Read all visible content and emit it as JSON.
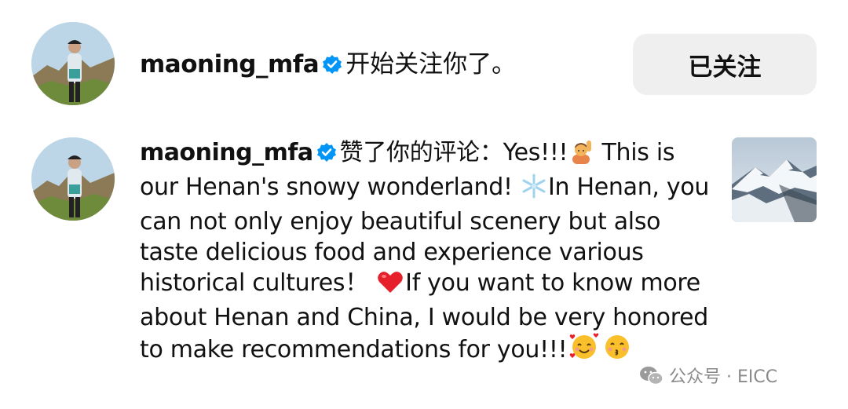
{
  "notifications": [
    {
      "username": "maoning_mfa",
      "action_text": "开始关注你了。",
      "button_label": "已关注"
    },
    {
      "username": "maoning_mfa",
      "action_text": "赞了你的评论：",
      "comment_parts": [
        "Yes!!!",
        " This is our Henan's snowy wonderland! ",
        "In Henan, you can not only enjoy beautiful scenery but also taste delicious food and experience various historical cultures！ ",
        "If you want to know more about Henan and China, I would be very honored to make recommendations for you!!!"
      ]
    }
  ],
  "watermark": {
    "text": "公众号 · EICC"
  },
  "icons": {
    "verified": "verified-badge-icon",
    "raising_hand": "person-raising-hand-emoji",
    "snowflake": "snowflake-emoji",
    "heart": "red-heart-emoji",
    "hearts_face": "smiling-face-with-hearts-emoji",
    "kissing_face": "kissing-face-with-smiling-eyes-emoji",
    "wechat": "wechat-icon"
  },
  "colors": {
    "verified_blue": "#0095f6",
    "button_bg": "#efefef",
    "text": "#111111",
    "watermark": "#8a8a8a"
  }
}
